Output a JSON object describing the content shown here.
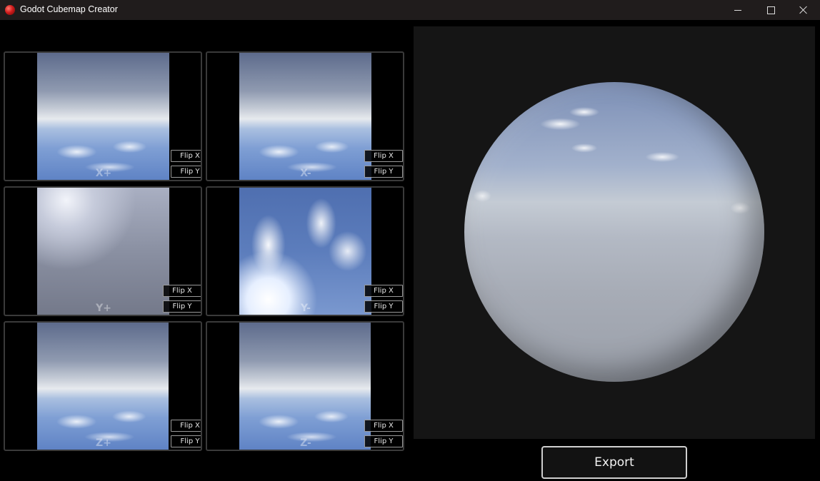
{
  "window": {
    "title": "Godot Cubemap Creator",
    "icon": "godot-app-icon",
    "controls": [
      "minimize-icon",
      "maximize-icon",
      "close-icon"
    ]
  },
  "faces": [
    {
      "label": "X+",
      "flip_x": "Flip X",
      "flip_y": "Flip Y",
      "style": "side"
    },
    {
      "label": "X-",
      "flip_x": "Flip X",
      "flip_y": "Flip Y",
      "style": "side"
    },
    {
      "label": "Y+",
      "flip_x": "Flip X",
      "flip_y": "Flip Y",
      "style": "top"
    },
    {
      "label": "Y-",
      "flip_x": "Flip X",
      "flip_y": "Flip Y",
      "style": "bottom"
    },
    {
      "label": "Z+",
      "flip_x": "Flip X",
      "flip_y": "Flip Y",
      "style": "side"
    },
    {
      "label": "Z-",
      "flip_x": "Flip X",
      "flip_y": "Flip Y",
      "style": "side"
    }
  ],
  "preview": {
    "content": "sky-reflection-sphere"
  },
  "export": {
    "label": "Export"
  },
  "colors": {
    "titlebar": "#201c1c",
    "background": "#000000",
    "preview_bg": "#151515",
    "panel_border": "#3a3a3a"
  }
}
